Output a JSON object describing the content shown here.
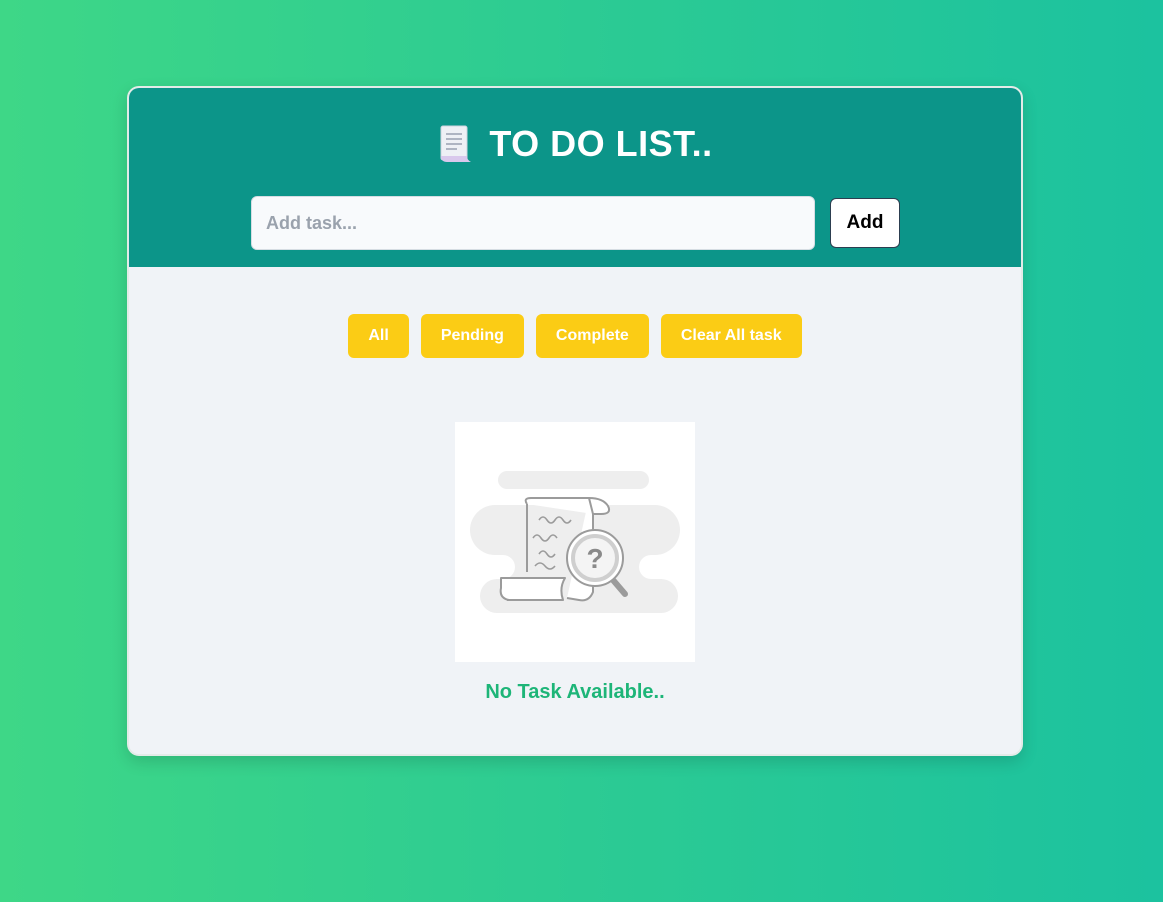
{
  "app": {
    "title": "TO DO LIST..",
    "title_icon": "document-icon"
  },
  "task_form": {
    "input_value": "",
    "input_placeholder": "Add task...",
    "add_label": "Add"
  },
  "filters": [
    {
      "label": "All"
    },
    {
      "label": "Pending"
    },
    {
      "label": "Complete"
    },
    {
      "label": "Clear All task"
    }
  ],
  "empty_state": {
    "illustration": "empty-search-illustration",
    "message": "No Task Available.."
  },
  "colors": {
    "header": "#0c9589",
    "accent_button": "#fbcc15",
    "empty_text": "#1db578",
    "background_start": "#3ed787",
    "background_end": "#1cc29f"
  }
}
